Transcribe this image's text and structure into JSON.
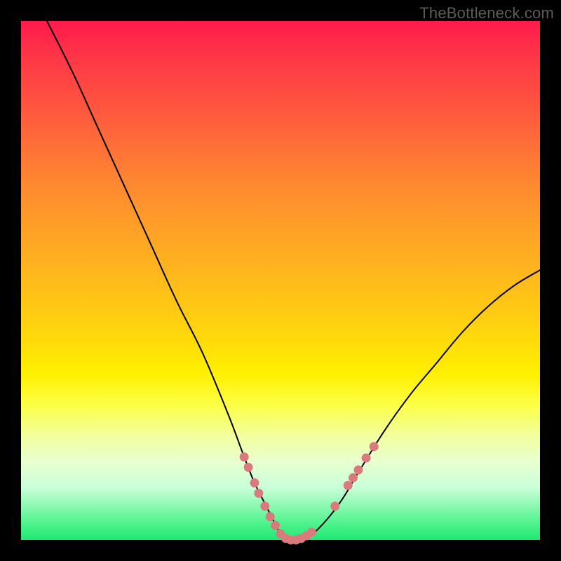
{
  "watermark": "TheBottleneck.com",
  "chart_data": {
    "type": "line",
    "title": "",
    "xlabel": "",
    "ylabel": "",
    "xlim": [
      0,
      100
    ],
    "ylim": [
      0,
      100
    ],
    "grid": false,
    "legend": false,
    "background": "rainbow-gradient red→green vertical",
    "series": [
      {
        "name": "bottleneck-curve",
        "x": [
          5,
          10,
          15,
          20,
          25,
          30,
          35,
          40,
          43,
          45,
          47,
          49,
          50,
          51,
          52,
          54,
          56,
          59,
          62,
          65,
          70,
          75,
          80,
          85,
          90,
          95,
          100
        ],
        "values": [
          100,
          90,
          79,
          68,
          57,
          46,
          36,
          24,
          16,
          11,
          7,
          3,
          1,
          0,
          0,
          0,
          1,
          4,
          8,
          13,
          21,
          28,
          34,
          40,
          45,
          49,
          52
        ]
      }
    ],
    "markers": {
      "name": "salmon-dots",
      "color": "#d97a7d",
      "points": [
        {
          "x": 43.0,
          "y": 16.0
        },
        {
          "x": 43.8,
          "y": 14.0
        },
        {
          "x": 45.0,
          "y": 11.0
        },
        {
          "x": 45.8,
          "y": 9.0
        },
        {
          "x": 47.0,
          "y": 6.5
        },
        {
          "x": 48.0,
          "y": 4.5
        },
        {
          "x": 49.0,
          "y": 2.8
        },
        {
          "x": 50.0,
          "y": 1.2
        },
        {
          "x": 51.0,
          "y": 0.3
        },
        {
          "x": 52.0,
          "y": 0.0
        },
        {
          "x": 53.0,
          "y": 0.0
        },
        {
          "x": 54.0,
          "y": 0.3
        },
        {
          "x": 55.0,
          "y": 0.8
        },
        {
          "x": 56.0,
          "y": 1.5
        },
        {
          "x": 60.5,
          "y": 6.5
        },
        {
          "x": 63.0,
          "y": 10.5
        },
        {
          "x": 64.0,
          "y": 12.0
        },
        {
          "x": 65.0,
          "y": 13.5
        },
        {
          "x": 66.5,
          "y": 15.8
        },
        {
          "x": 68.0,
          "y": 18.0
        }
      ]
    }
  }
}
